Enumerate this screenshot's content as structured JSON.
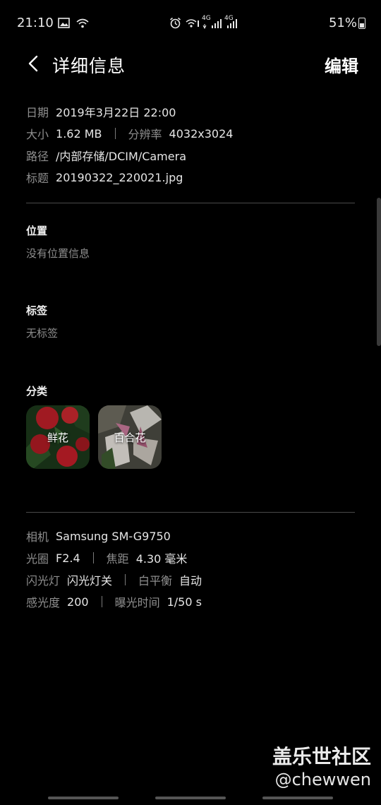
{
  "status_bar": {
    "time": "21:10",
    "battery": "51%",
    "network": "4G",
    "icons": [
      "image-icon",
      "wifi-icon",
      "alarm-icon",
      "wifi-call-icon",
      "signal-4g-icon",
      "signal-4g-icon",
      "battery-icon"
    ]
  },
  "header": {
    "title": "详细信息",
    "edit_label": "编辑"
  },
  "info": {
    "date_label": "日期",
    "date_value": "2019年3月22日 22:00",
    "size_label": "大小",
    "size_value": "1.62 MB",
    "resolution_label": "分辨率",
    "resolution_value": "4032x3024",
    "path_label": "路径",
    "path_value": "/内部存储/DCIM/Camera",
    "name_label": "标题",
    "name_value": "20190322_220021.jpg"
  },
  "location": {
    "title": "位置",
    "text": "没有位置信息"
  },
  "tags": {
    "title": "标签",
    "text": "无标签"
  },
  "categories": {
    "title": "分类",
    "items": [
      {
        "label": "鲜花"
      },
      {
        "label": "百合花"
      }
    ]
  },
  "camera": {
    "camera_label": "相机",
    "camera_value": "Samsung SM-G9750",
    "aperture_label": "光圈",
    "aperture_value": "F2.4",
    "focal_label": "焦距",
    "focal_value": "4.30 毫米",
    "flash_label": "闪光灯",
    "flash_value": "闪光灯关",
    "wb_label": "白平衡",
    "wb_value": "自动",
    "iso_label": "感光度",
    "iso_value": "200",
    "exposure_label": "曝光时间",
    "exposure_value": "1/50 s"
  },
  "watermark": {
    "site": "盖乐世社区",
    "user": "@chewwen"
  }
}
